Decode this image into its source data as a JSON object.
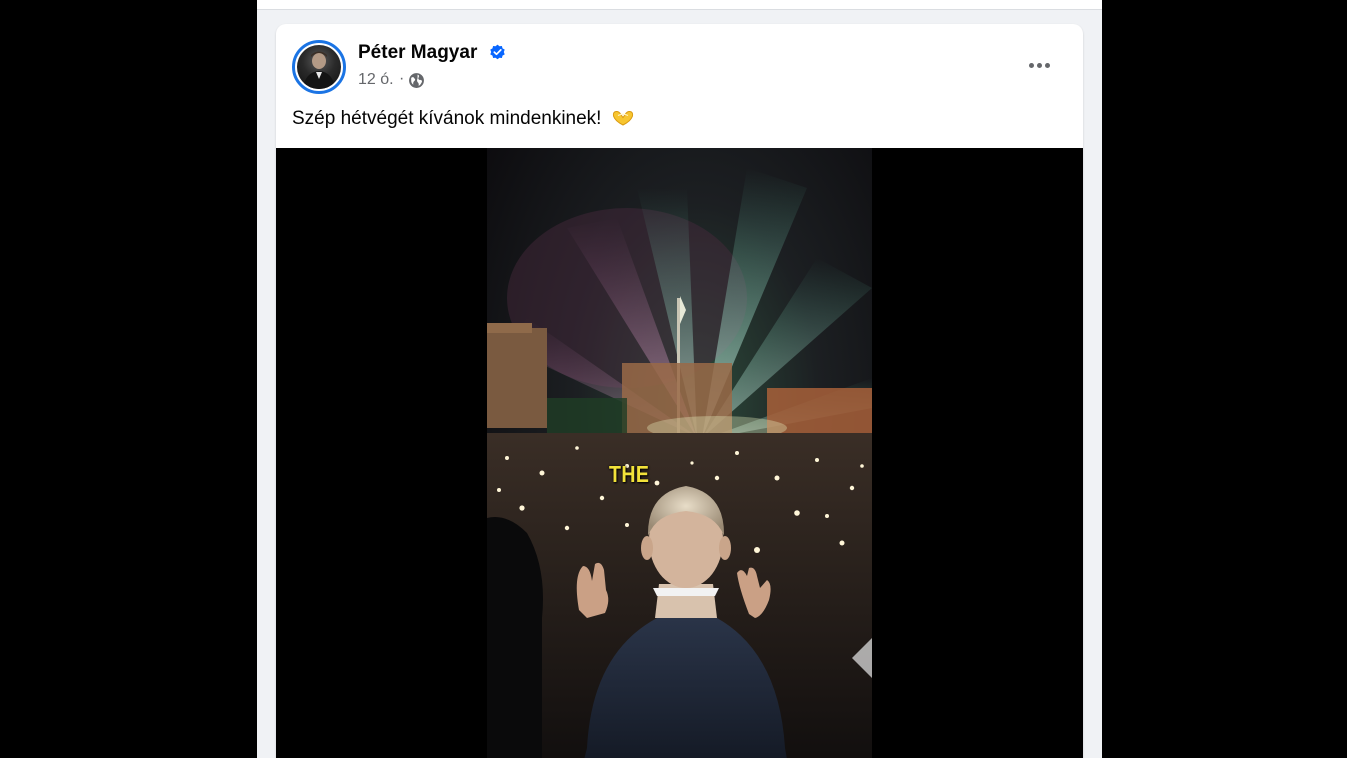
{
  "post": {
    "author": "Péter Magyar",
    "verified": true,
    "time": "12 ó.",
    "separator": "·",
    "audience_icon": "globe-icon",
    "text": "Szép hétvégét kívánok mindenkinek!",
    "emoji_icon": "heart-hands-icon",
    "more_icon": "more-options-icon"
  },
  "video": {
    "caption": "THE"
  },
  "colors": {
    "verified_blue": "#0866ff",
    "secondary_text": "#65676b",
    "caption_yellow": "#f2e23a",
    "feed_bg": "#f0f2f5"
  }
}
